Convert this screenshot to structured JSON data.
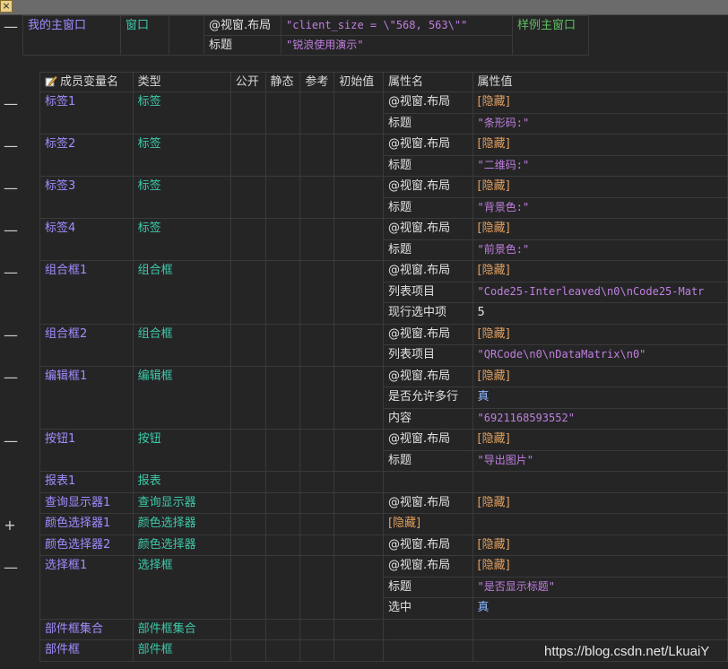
{
  "close_label": "×",
  "window_row": {
    "name": "我的主窗口",
    "type": "窗口",
    "props": [
      {
        "key": "@视窗.布局",
        "value": "\"client_size = \\\"568, 563\\\"\""
      },
      {
        "key": "标题",
        "value": "\"锐浪使用演示\""
      }
    ],
    "sample_name": "样例主窗口"
  },
  "headers": {
    "member_var": "成员变量名",
    "type": "类型",
    "public": "公开",
    "static": "静态",
    "ref": "参考",
    "init": "初始值",
    "prop_name": "属性名",
    "prop_value": "属性值"
  },
  "members": [
    {
      "name": "标签1",
      "type": "标签",
      "toggle": "—",
      "props": [
        {
          "key": "@视窗.布局",
          "value": "[隐藏]",
          "kind": "hid"
        },
        {
          "key": "标题",
          "value": "\"条形码:\"",
          "kind": "str"
        }
      ]
    },
    {
      "name": "标签2",
      "type": "标签",
      "toggle": "—",
      "props": [
        {
          "key": "@视窗.布局",
          "value": "[隐藏]",
          "kind": "hid"
        },
        {
          "key": "标题",
          "value": "\"二维码:\"",
          "kind": "str"
        }
      ]
    },
    {
      "name": "标签3",
      "type": "标签",
      "toggle": "—",
      "props": [
        {
          "key": "@视窗.布局",
          "value": "[隐藏]",
          "kind": "hid"
        },
        {
          "key": "标题",
          "value": "\"背景色:\"",
          "kind": "str"
        }
      ]
    },
    {
      "name": "标签4",
      "type": "标签",
      "toggle": "—",
      "props": [
        {
          "key": "@视窗.布局",
          "value": "[隐藏]",
          "kind": "hid"
        },
        {
          "key": "标题",
          "value": "\"前景色:\"",
          "kind": "str"
        }
      ]
    },
    {
      "name": "组合框1",
      "type": "组合框",
      "toggle": "—",
      "props": [
        {
          "key": "@视窗.布局",
          "value": "[隐藏]",
          "kind": "hid"
        },
        {
          "key": "列表项目",
          "value": "\"Code25-Interleaved\\n0\\nCode25-Matr",
          "kind": "str"
        },
        {
          "key": "现行选中项",
          "value": "5",
          "kind": "white"
        }
      ]
    },
    {
      "name": "组合框2",
      "type": "组合框",
      "toggle": "—",
      "props": [
        {
          "key": "@视窗.布局",
          "value": "[隐藏]",
          "kind": "hid"
        },
        {
          "key": "列表项目",
          "value": "\"QRCode\\n0\\nDataMatrix\\n0\"",
          "kind": "str"
        }
      ]
    },
    {
      "name": "编辑框1",
      "type": "编辑框",
      "toggle": "—",
      "props": [
        {
          "key": "@视窗.布局",
          "value": "[隐藏]",
          "kind": "hid"
        },
        {
          "key": "是否允许多行",
          "value": "真",
          "kind": "val"
        },
        {
          "key": "内容",
          "value": "\"6921168593552\"",
          "kind": "str"
        }
      ]
    },
    {
      "name": "按钮1",
      "type": "按钮",
      "toggle": "—",
      "props": [
        {
          "key": "@视窗.布局",
          "value": "[隐藏]",
          "kind": "hid"
        },
        {
          "key": "标题",
          "value": "\"导出图片\"",
          "kind": "str"
        }
      ]
    },
    {
      "name": "报表1",
      "type": "报表",
      "toggle": "",
      "props": [
        {
          "key": "",
          "value": "",
          "kind": "white"
        }
      ]
    },
    {
      "name": "查询显示器1",
      "type": "查询显示器",
      "toggle": "",
      "props": [
        {
          "key": "@视窗.布局",
          "value": "[隐藏]",
          "kind": "hid"
        }
      ]
    },
    {
      "name": "颜色选择器1",
      "type": "颜色选择器",
      "toggle": "+",
      "props": [
        {
          "key": "[隐藏]",
          "value": "",
          "kind": "hid",
          "key_kind": "hid"
        }
      ]
    },
    {
      "name": "颜色选择器2",
      "type": "颜色选择器",
      "toggle": "",
      "props": [
        {
          "key": "@视窗.布局",
          "value": "[隐藏]",
          "kind": "hid"
        }
      ]
    },
    {
      "name": "选择框1",
      "type": "选择框",
      "toggle": "—",
      "props": [
        {
          "key": "@视窗.布局",
          "value": "[隐藏]",
          "kind": "hid"
        },
        {
          "key": "标题",
          "value": "\"是否显示标题\"",
          "kind": "str"
        },
        {
          "key": "选中",
          "value": "真",
          "kind": "val"
        }
      ]
    },
    {
      "name": "部件框集合",
      "type": "部件框集合",
      "toggle": "",
      "props": [
        {
          "key": "",
          "value": "",
          "kind": "white"
        }
      ]
    },
    {
      "name": "部件框",
      "type": "部件框",
      "toggle": "",
      "props": [
        {
          "key": "",
          "value": "",
          "kind": "white"
        }
      ]
    }
  ],
  "watermark": "https://blog.csdn.net/LkuaiY",
  "colors": {
    "background": "#252526",
    "member_name": "#a38cff",
    "type": "#3dc9a8",
    "string": "#c17fe0",
    "hidden": "#e0a060",
    "bool": "#8cb8ff"
  }
}
